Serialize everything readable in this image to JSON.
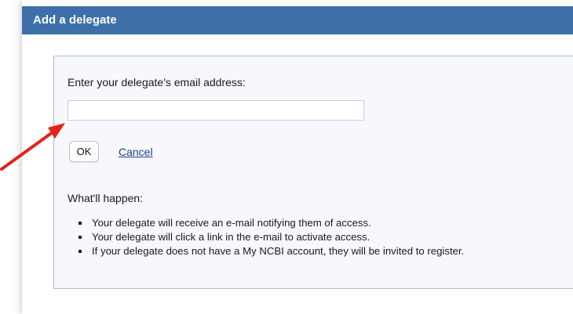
{
  "dialog": {
    "title": "Add a delegate"
  },
  "form": {
    "email_label": "Enter your delegate's email address:",
    "email_value": "",
    "ok_label": "OK",
    "cancel_label": "Cancel"
  },
  "info": {
    "heading": "What'll happen:",
    "items": [
      "Your delegate will receive an e-mail notifying them of access.",
      "Your delegate will click a link in the e-mail to activate access.",
      "If your delegate does not have a My NCBI account, they will be invited to register."
    ]
  },
  "colors": {
    "header": "#3d6fa8",
    "panel_bg": "#f6f8fb",
    "panel_border": "#a9bcd3",
    "link": "#1f3f9a",
    "annotation_arrow": "#e3231b"
  },
  "icons": {
    "annotation": "red-arrow-icon"
  }
}
